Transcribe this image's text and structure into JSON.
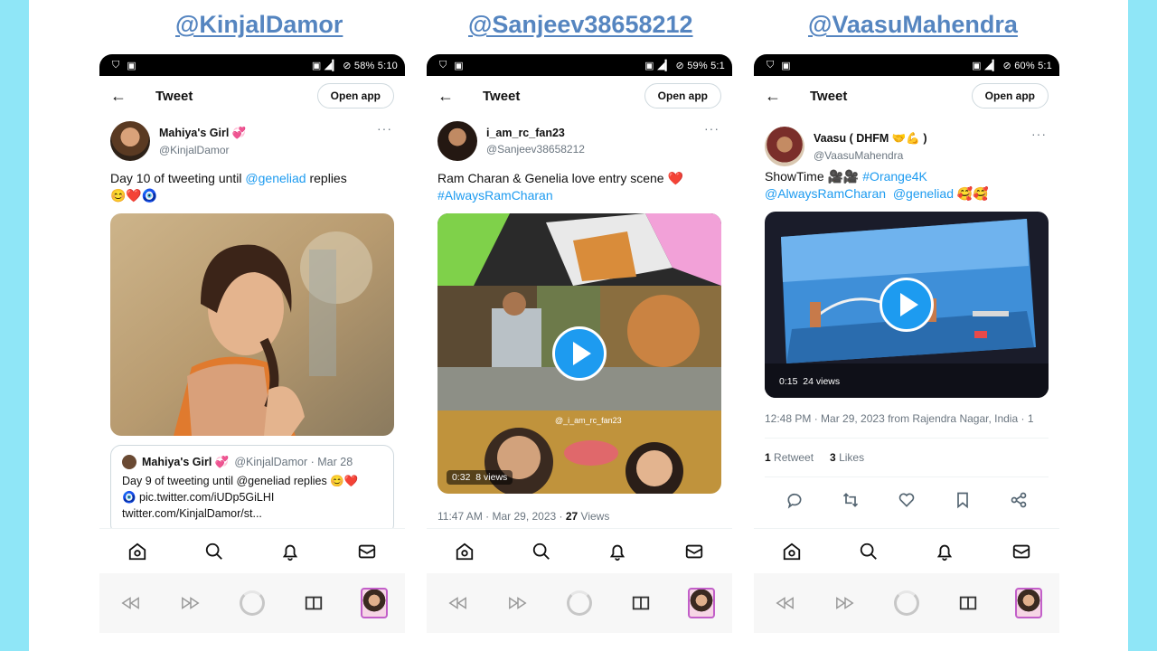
{
  "page": {
    "background_color": "#8fe6f7",
    "handle_color": "#5585c0",
    "accent_color": "#1d9bf0"
  },
  "phones": [
    {
      "handle_label": "@KinjalDamor",
      "status": {
        "right": "▣ ◢▎ ⊘ 58% 5:10"
      },
      "topbar": {
        "back": "←",
        "title": "Tweet",
        "open_app": "Open app"
      },
      "user": {
        "name": "Mahiya's Girl 💞",
        "handle": "@KinjalDamor",
        "more": "···"
      },
      "tweet": {
        "text_before": "Day 10 of tweeting until ",
        "mention": "@geneliad",
        "text_after": " replies",
        "emoji": "😊❤️🧿"
      },
      "quote": {
        "name": "Mahiya's Girl 💞",
        "meta": "@KinjalDamor · Mar 28",
        "line1": "Day 9 of tweeting until @geneliad replies 😊❤️",
        "line2": "🧿 pic.twitter.com/iUDp5GiLHI",
        "line3": "twitter.com/KinjalDamor/st..."
      }
    },
    {
      "handle_label": "@Sanjeev38658212",
      "status": {
        "right": "▣ ◢▎ ⊘ 59% 5:1"
      },
      "topbar": {
        "back": "←",
        "title": "Tweet",
        "open_app": "Open app"
      },
      "user": {
        "name": "i_am_rc_fan23",
        "handle": "@Sanjeev38658212",
        "more": "···"
      },
      "tweet": {
        "text": "Ram Charan & Genelia love entry scene ❤️",
        "hashtag": "#AlwaysRamCharan"
      },
      "video": {
        "overlay_tag": "@_i_am_rc_fan23",
        "duration": "0:32",
        "views": "8 views"
      },
      "meta": {
        "time": "11:47 AM · Mar 29, 2023 · ",
        "views_count": "27",
        "views_label": " Views"
      }
    },
    {
      "handle_label": "@VaasuMahendra",
      "status": {
        "right": "▣ ◢▎ ⊘ 60% 5:1"
      },
      "topbar": {
        "back": "←",
        "title": "Tweet",
        "open_app": "Open app"
      },
      "user": {
        "name": "Vaasu ( DHFM 🤝💪 )",
        "handle": "@VaasuMahendra",
        "more": "···"
      },
      "tweet": {
        "text": "ShowTime 🎥🎥 ",
        "hashtag": "#Orange4K",
        "mention1": "@AlwaysRamCharan",
        "mention2": "@geneliad",
        "emoji": " 🥰🥰"
      },
      "video": {
        "duration": "0:15",
        "views": "24 views"
      },
      "meta": {
        "time": "12:48 PM · Mar 29, 2023 from Rajendra Nagar, India · 1"
      },
      "stats": {
        "retweets_count": "1",
        "retweets_label": " Retweet",
        "likes_count": "3",
        "likes_label": " Likes"
      }
    }
  ],
  "icons": {
    "bottom_nav": [
      "home-icon",
      "search-icon",
      "bell-icon",
      "mail-icon"
    ],
    "system_nav": [
      "rewind-icon",
      "forward-icon",
      "loading-circle-icon",
      "book-icon",
      "app-thumbnail"
    ],
    "actions": [
      "reply-icon",
      "retweet-icon",
      "like-icon",
      "bookmark-icon",
      "share-icon"
    ]
  }
}
